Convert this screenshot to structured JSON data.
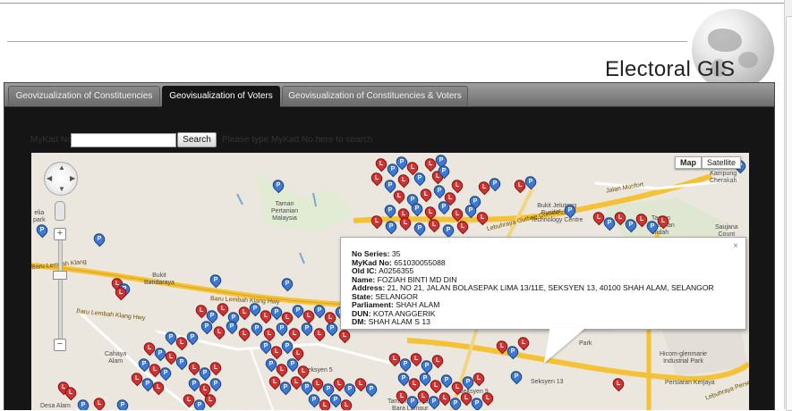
{
  "app": {
    "brand_title": "Electoral GIS"
  },
  "tabs": [
    {
      "label": "Geovizualization of Constituencies",
      "active": false
    },
    {
      "label": "Geovisualization of Voters",
      "active": true
    },
    {
      "label": "Geovisualization of Constituencies & Voters",
      "active": false
    }
  ],
  "search": {
    "label": "MyKad No :",
    "value": "",
    "button_label": "Search",
    "hint": "Please type MyKad No here to search"
  },
  "map": {
    "map_type_buttons": [
      {
        "label": "Map",
        "selected": true
      },
      {
        "label": "Satellite",
        "selected": false
      }
    ],
    "zoom_in_label": "+",
    "zoom_out_label": "−",
    "marker_letters": {
      "p": "P",
      "l": "L"
    },
    "colors": {
      "p_marker": "#3b78d8",
      "l_marker": "#d8302e",
      "highway": "#f5c236"
    },
    "place_labels": {
      "taman_pertanian": "Taman\nPertanian\nMalaysia",
      "bukit_bandaraya": "Bukit\nBandaraya",
      "bukit_jelutong": "Bukit Jelutong\nBusiness &\nTechnology Centre",
      "taman_industri": "Taman\nIndustrian\nIndah",
      "saujana": "Saujana\nCount",
      "kampung_cherakah": "Kampung\nCherakah",
      "cahaya_alam": "Cahaya\nAlam",
      "seksyen5": "Seksyen 5",
      "seksyen13": "Seksyen 13",
      "hicom": "Hicom-glenmarie\nIndustrial Park",
      "taman_rekreasi": "Taman Rekreasi\nBara Lumpur",
      "persiaran_kerjaya": "Persiaran Kerjaya",
      "desa_alam": "Desa Alam",
      "park": "Park",
      "seksyen9": "Seksyen 9",
      "elia_park": "elia\npark"
    },
    "road_labels": {
      "lembah_klang_hwy": "Baru Lembah Klang Hwy",
      "lembah_klang_hwy2": "Baru Lembah Klang Hwy",
      "jalan_monfort": "Jalan Monfort",
      "guthrie": "Lebuhraya Guthrie Corridor",
      "lembah_klang_left": "Baru Lembah Klang",
      "pers_kerjaya_right": "Lebuhraya Persek"
    }
  },
  "info_window": {
    "fields": [
      {
        "label": "No Series:",
        "value": "35"
      },
      {
        "label": "MyKad No:",
        "value": "651030055088"
      },
      {
        "label": "Old IC:",
        "value": "A0256355"
      },
      {
        "label": "Name:",
        "value": "FOZIAH BINTI MD DIN"
      },
      {
        "label": "Address:",
        "value": "21, NO 21, JALAN BOLASEPAK LIMA 13/11E, SEKSYEN 13, 40100 SHAH ALAM, SELANGOR"
      },
      {
        "label": "State:",
        "value": "SELANGOR"
      },
      {
        "label": "Parliament:",
        "value": "SHAH ALAM"
      },
      {
        "label": "DUN:",
        "value": "KOTA ANGGERIK"
      },
      {
        "label": "DM:",
        "value": "SHAH ALAM S 13"
      }
    ],
    "close_glyph": "×"
  }
}
